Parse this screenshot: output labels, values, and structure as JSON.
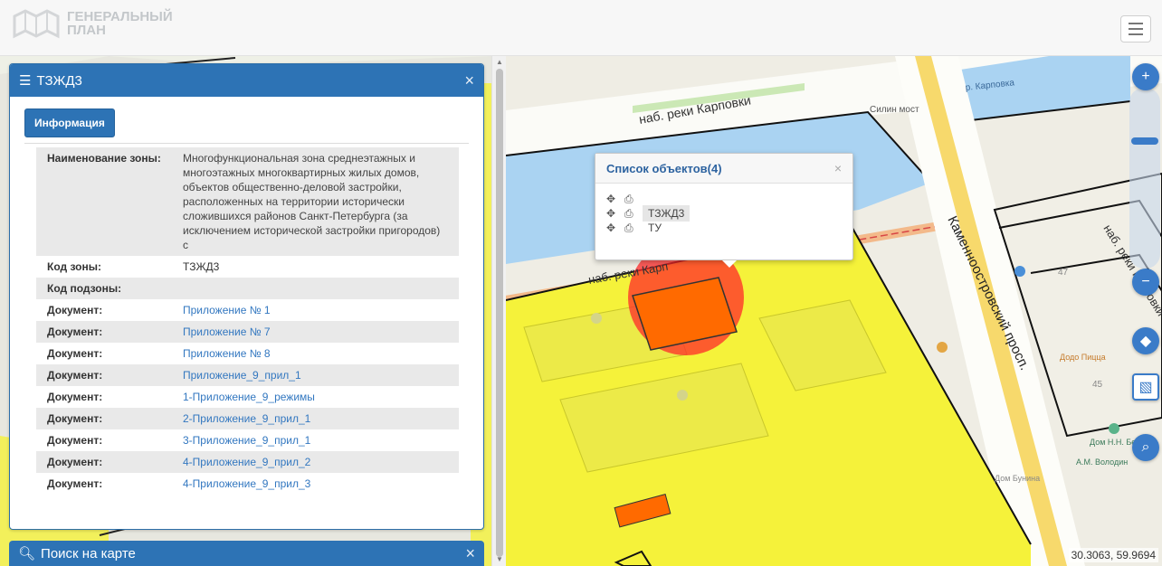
{
  "header": {
    "logo_line1": "ГЕНЕРАЛЬНЫЙ",
    "logo_line2": "ПЛАН"
  },
  "panel": {
    "title": "ТЗЖД3",
    "info_button": "Информация",
    "rows": [
      {
        "key": "Наименование зоны:",
        "value": "Многофункциональная зона среднеэтажных и многоэтажных многоквартирных жилых домов, объектов общественно-деловой застройки, расположенных на территории исторически сложившихся районов Санкт-Петербурга (за исключением исторической застройки пригородов) с",
        "link": false
      },
      {
        "key": "Код зоны:",
        "value": "ТЗЖД3",
        "link": false
      },
      {
        "key": "Код подзоны:",
        "value": "",
        "link": false
      },
      {
        "key": "Документ:",
        "value": "Приложение № 1",
        "link": true
      },
      {
        "key": "Документ:",
        "value": "Приложение № 7",
        "link": true
      },
      {
        "key": "Документ:",
        "value": "Приложение № 8",
        "link": true
      },
      {
        "key": "Документ:",
        "value": "Приложение_9_прил_1",
        "link": true
      },
      {
        "key": "Документ:",
        "value": "1-Приложение_9_режимы",
        "link": true
      },
      {
        "key": "Документ:",
        "value": "2-Приложение_9_прил_1",
        "link": true
      },
      {
        "key": "Документ:",
        "value": "3-Приложение_9_прил_1",
        "link": true
      },
      {
        "key": "Документ:",
        "value": "4-Приложение_9_прил_2",
        "link": true
      },
      {
        "key": "Документ:",
        "value": "4-Приложение_9_прил_3",
        "link": true
      }
    ]
  },
  "search_panel": {
    "title": "Поиск на карте"
  },
  "popup": {
    "title": "Список объектов(4)",
    "items": [
      "",
      "ТЗЖД3",
      "ТУ"
    ]
  },
  "map": {
    "labels": {
      "river_emb_top": "наб. реки Карповки",
      "river_emb_mid": "наб. реки Карп",
      "bridge": "Силин мост",
      "river": "р. Карповка",
      "prospect": "Каменноостровский просп.",
      "emb_right": "наб. реки Карповки",
      "num_47": "47",
      "num_45": "45",
      "poi_1": "Дом Бунина",
      "poi_2": "Дом Н.Н. Бенуа",
      "poi_3": "Додо Пицца",
      "poi_4": "А.М. Володин"
    },
    "coords": "30.3063, 59.9694",
    "colors": {
      "zone_yellow": "#f5f23a",
      "water": "#aad3f2",
      "building": "#ff6a00",
      "selection": "#ff2a2a"
    }
  },
  "icons": {
    "menu": "menu-icon",
    "list": "list-icon",
    "close": "close-icon",
    "search": "search-icon",
    "move": "move-icon",
    "print": "print-icon",
    "zoom_in": "plus-icon",
    "zoom_out": "minus-icon",
    "layers": "layers-icon",
    "draw": "draw-icon"
  }
}
